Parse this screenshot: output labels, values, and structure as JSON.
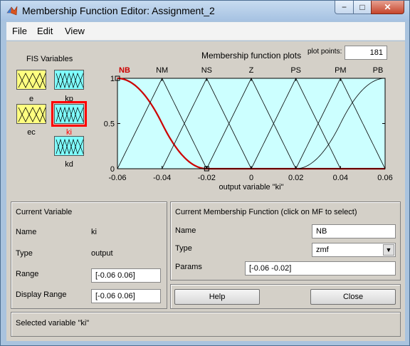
{
  "window": {
    "title": "Membership Function Editor: Assignment_2",
    "min_glyph": "−",
    "max_glyph": "□",
    "close_glyph": "✕"
  },
  "menu": [
    "File",
    "Edit",
    "View"
  ],
  "fis": {
    "title": "FIS Variables",
    "inputs": [
      {
        "name": "e"
      },
      {
        "name": "ec"
      }
    ],
    "outputs": [
      {
        "name": "kp"
      },
      {
        "name": "ki",
        "selected": true
      },
      {
        "name": "kd"
      }
    ]
  },
  "plot": {
    "title": "Membership function plots",
    "plot_points_label": "plot points:",
    "plot_points": "181",
    "xlabel": "output variable \"ki\"",
    "xticks": [
      "-0.06",
      "-0.04",
      "-0.02",
      "0",
      "0.02",
      "0.04",
      "0.06"
    ],
    "yticks": [
      "0",
      "0.5",
      "1"
    ]
  },
  "chart_data": {
    "type": "line",
    "x_range": [
      -0.06,
      0.06
    ],
    "ylim": [
      0,
      1
    ],
    "series": [
      {
        "name": "NB",
        "shape": "zmf",
        "params": [
          -0.06,
          -0.02
        ],
        "selected": true
      },
      {
        "name": "NM",
        "shape": "trimf",
        "params": [
          -0.06,
          -0.04,
          -0.02
        ]
      },
      {
        "name": "NS",
        "shape": "trimf",
        "params": [
          -0.04,
          -0.02,
          0
        ]
      },
      {
        "name": "Z",
        "shape": "trimf",
        "params": [
          -0.02,
          0,
          0.02
        ]
      },
      {
        "name": "PS",
        "shape": "trimf",
        "params": [
          0,
          0.02,
          0.04
        ]
      },
      {
        "name": "PM",
        "shape": "trimf",
        "params": [
          0.02,
          0.04,
          0.06
        ]
      },
      {
        "name": "PB",
        "shape": "smf",
        "params": [
          0.02,
          0.06
        ]
      }
    ]
  },
  "current_variable": {
    "title": "Current Variable",
    "name_label": "Name",
    "name_value": "ki",
    "type_label": "Type",
    "type_value": "output",
    "range_label": "Range",
    "range_value": "[-0.06 0.06]",
    "display_range_label": "Display Range",
    "display_range_value": "[-0.06 0.06]"
  },
  "current_mf": {
    "title": "Current Membership Function (click on MF to select)",
    "name_label": "Name",
    "name_value": "NB",
    "type_label": "Type",
    "type_value": "zmf",
    "params_label": "Params",
    "params_value": "[-0.06 -0.02]"
  },
  "buttons": {
    "help": "Help",
    "close": "Close"
  },
  "status": "Selected variable \"ki\"",
  "colors": {
    "plot_bg": "#ccffff",
    "selected_mf": "#cc0000",
    "input_var": "#ffff80",
    "output_var": "#80ffff"
  }
}
